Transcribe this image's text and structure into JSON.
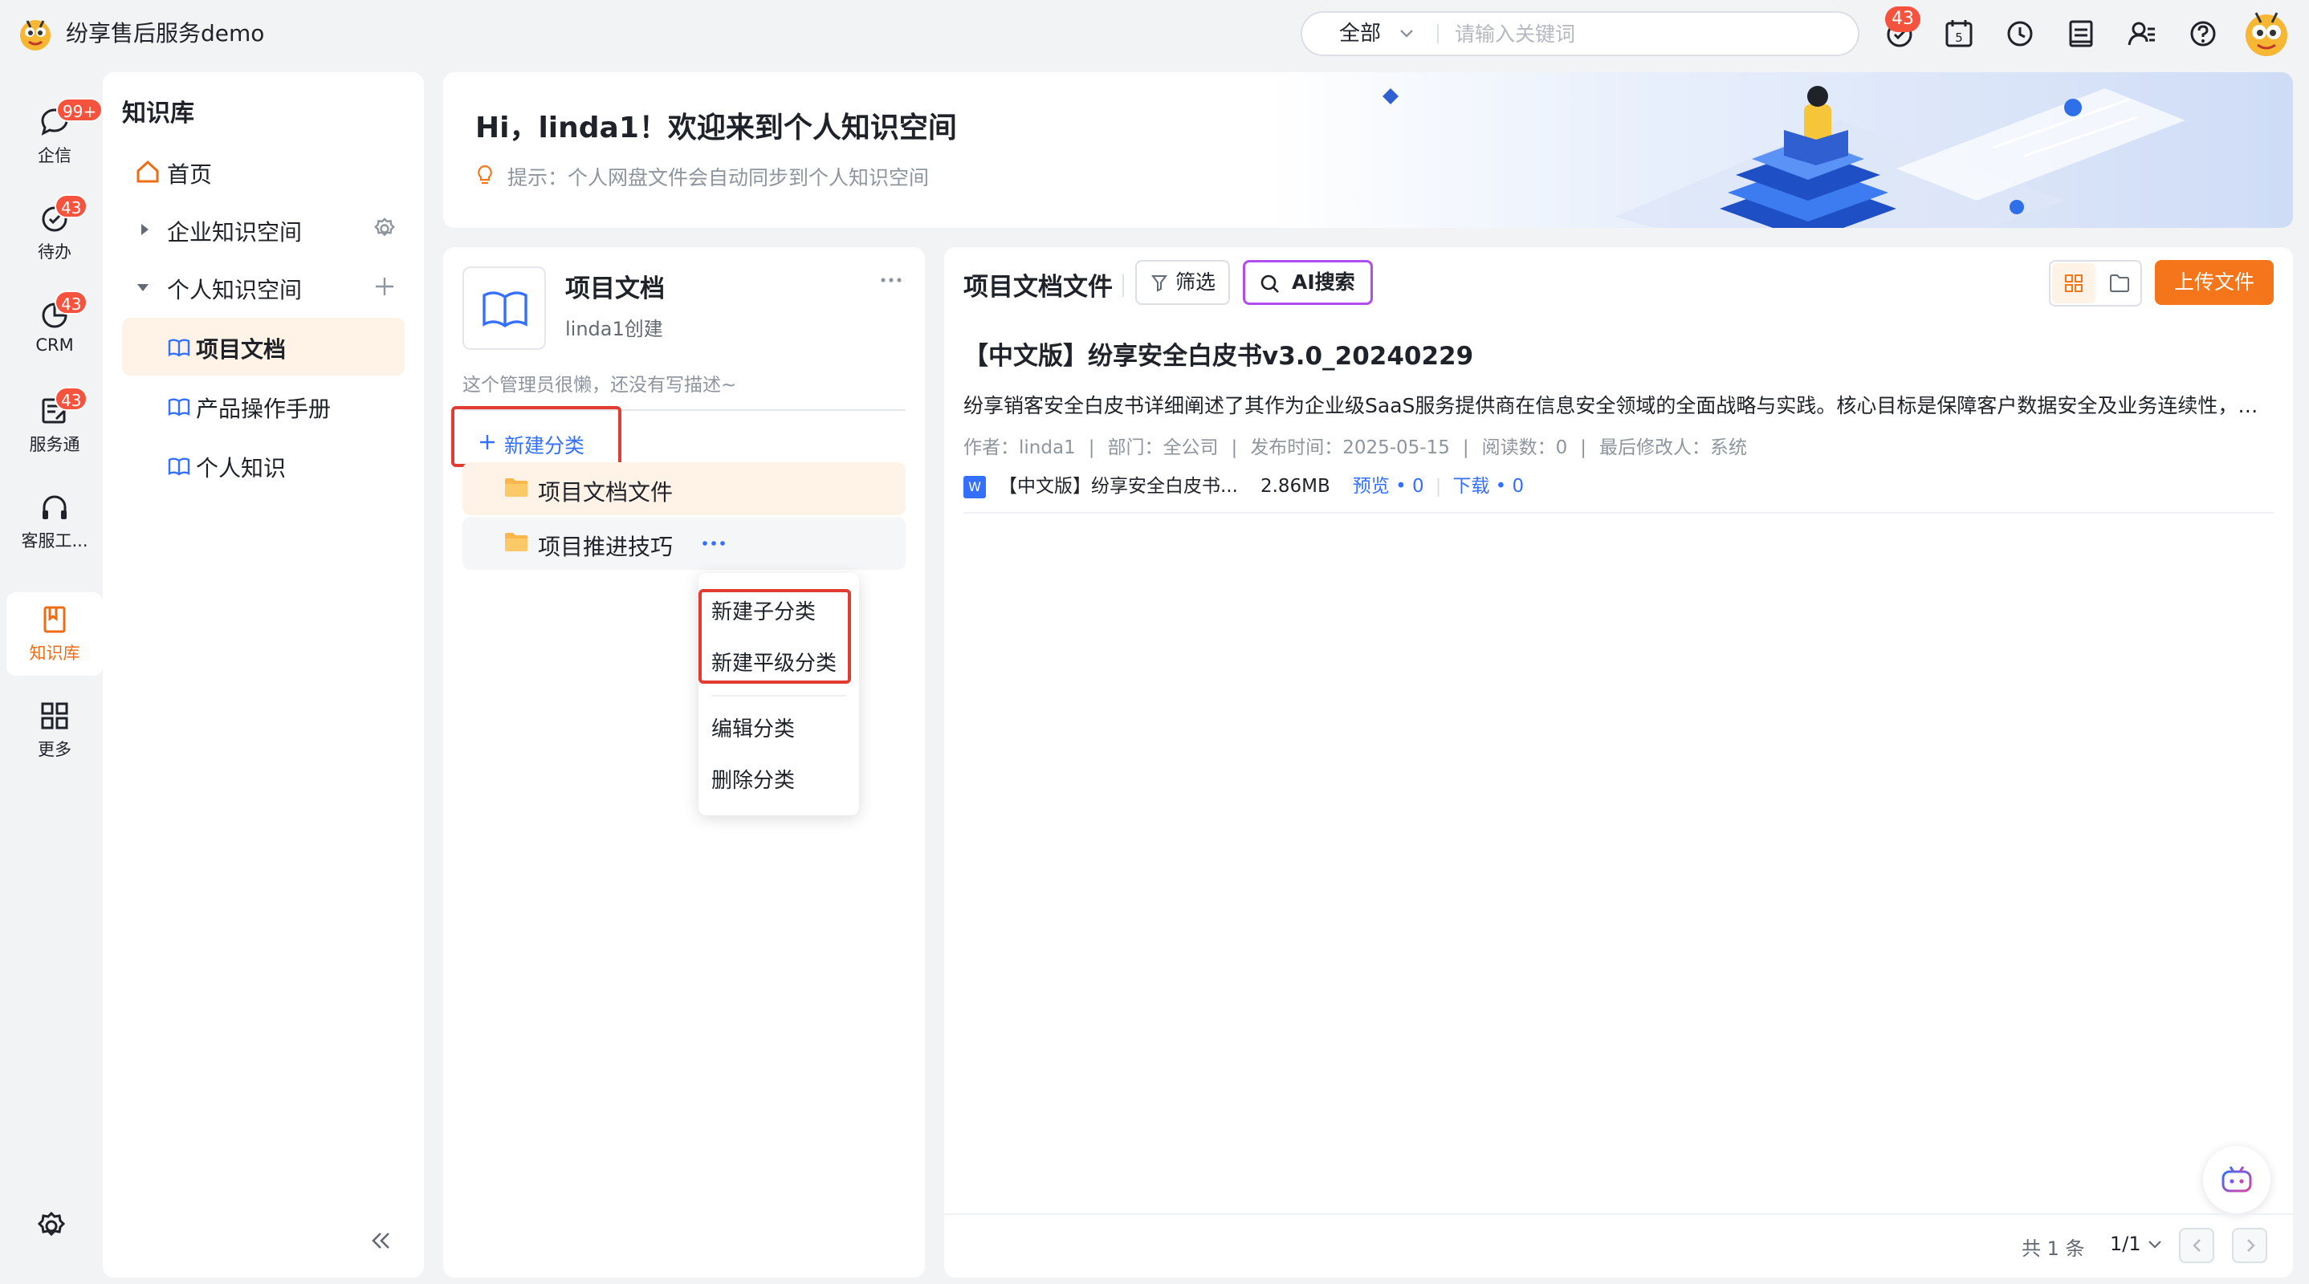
{
  "app": {
    "title": "纷享售后服务demo"
  },
  "topbar": {
    "search_scope": "全部",
    "search_placeholder": "请输入关键词",
    "notification_count": "43",
    "calendar_day": "5"
  },
  "rail": [
    {
      "label": "企信",
      "badge": "99+"
    },
    {
      "label": "待办",
      "badge": "43"
    },
    {
      "label": "CRM",
      "badge": "43"
    },
    {
      "label": "服务通",
      "badge": "43"
    },
    {
      "label": "客服工作台",
      "badge": ""
    },
    {
      "label": "知识库",
      "badge": ""
    },
    {
      "label": "更多",
      "badge": ""
    }
  ],
  "sidebar": {
    "title": "知识库",
    "home": "首页",
    "enterprise": "企业知识空间",
    "personal": "个人知识空间",
    "items": [
      "项目文档",
      "产品操作手册",
      "个人知识"
    ]
  },
  "banner": {
    "greeting": "Hi，linda1！欢迎来到个人知识空间",
    "hint": "提示：个人网盘文件会自动同步到个人知识空间"
  },
  "category": {
    "title": "项目文档",
    "creator": "linda1创建",
    "description": "这个管理员很懒，还没有写描述~",
    "new_label": "新建分类",
    "folders": [
      "项目文档文件",
      "项目推进技巧"
    ],
    "menu": [
      "新建子分类",
      "新建平级分类",
      "编辑分类",
      "删除分类"
    ]
  },
  "content": {
    "title": "项目文档文件",
    "filter_label": "筛选",
    "ai_search_label": "AI搜索",
    "upload_label": "上传文件",
    "doc": {
      "title": "【中文版】纷享安全白皮书v3.0_20240229",
      "summary": "纷享销客安全白皮书详细阐述了其作为企业级SaaS服务提供商在信息安全领域的全面战略与实践。核心目标是保障客户数据安全及业务连续性，涵盖组织架构、安全管理体系、数据保护与合规认证等方面。",
      "author": "作者：linda1",
      "dept": "部门：全公司",
      "published": "发布时间：2025-05-15",
      "reads": "阅读数：0",
      "modifier": "最后修改人：系统",
      "file_name": "【中文版】纷享安全白皮书...",
      "file_size": "2.86MB",
      "preview": "预览 • 0",
      "download": "下载 • 0"
    },
    "total": "共 1 条",
    "page": "1/1"
  },
  "colors": {
    "accent": "#f5761a",
    "link": "#3370ff",
    "highlight": "#e23c32",
    "badge": "#f5533d"
  }
}
